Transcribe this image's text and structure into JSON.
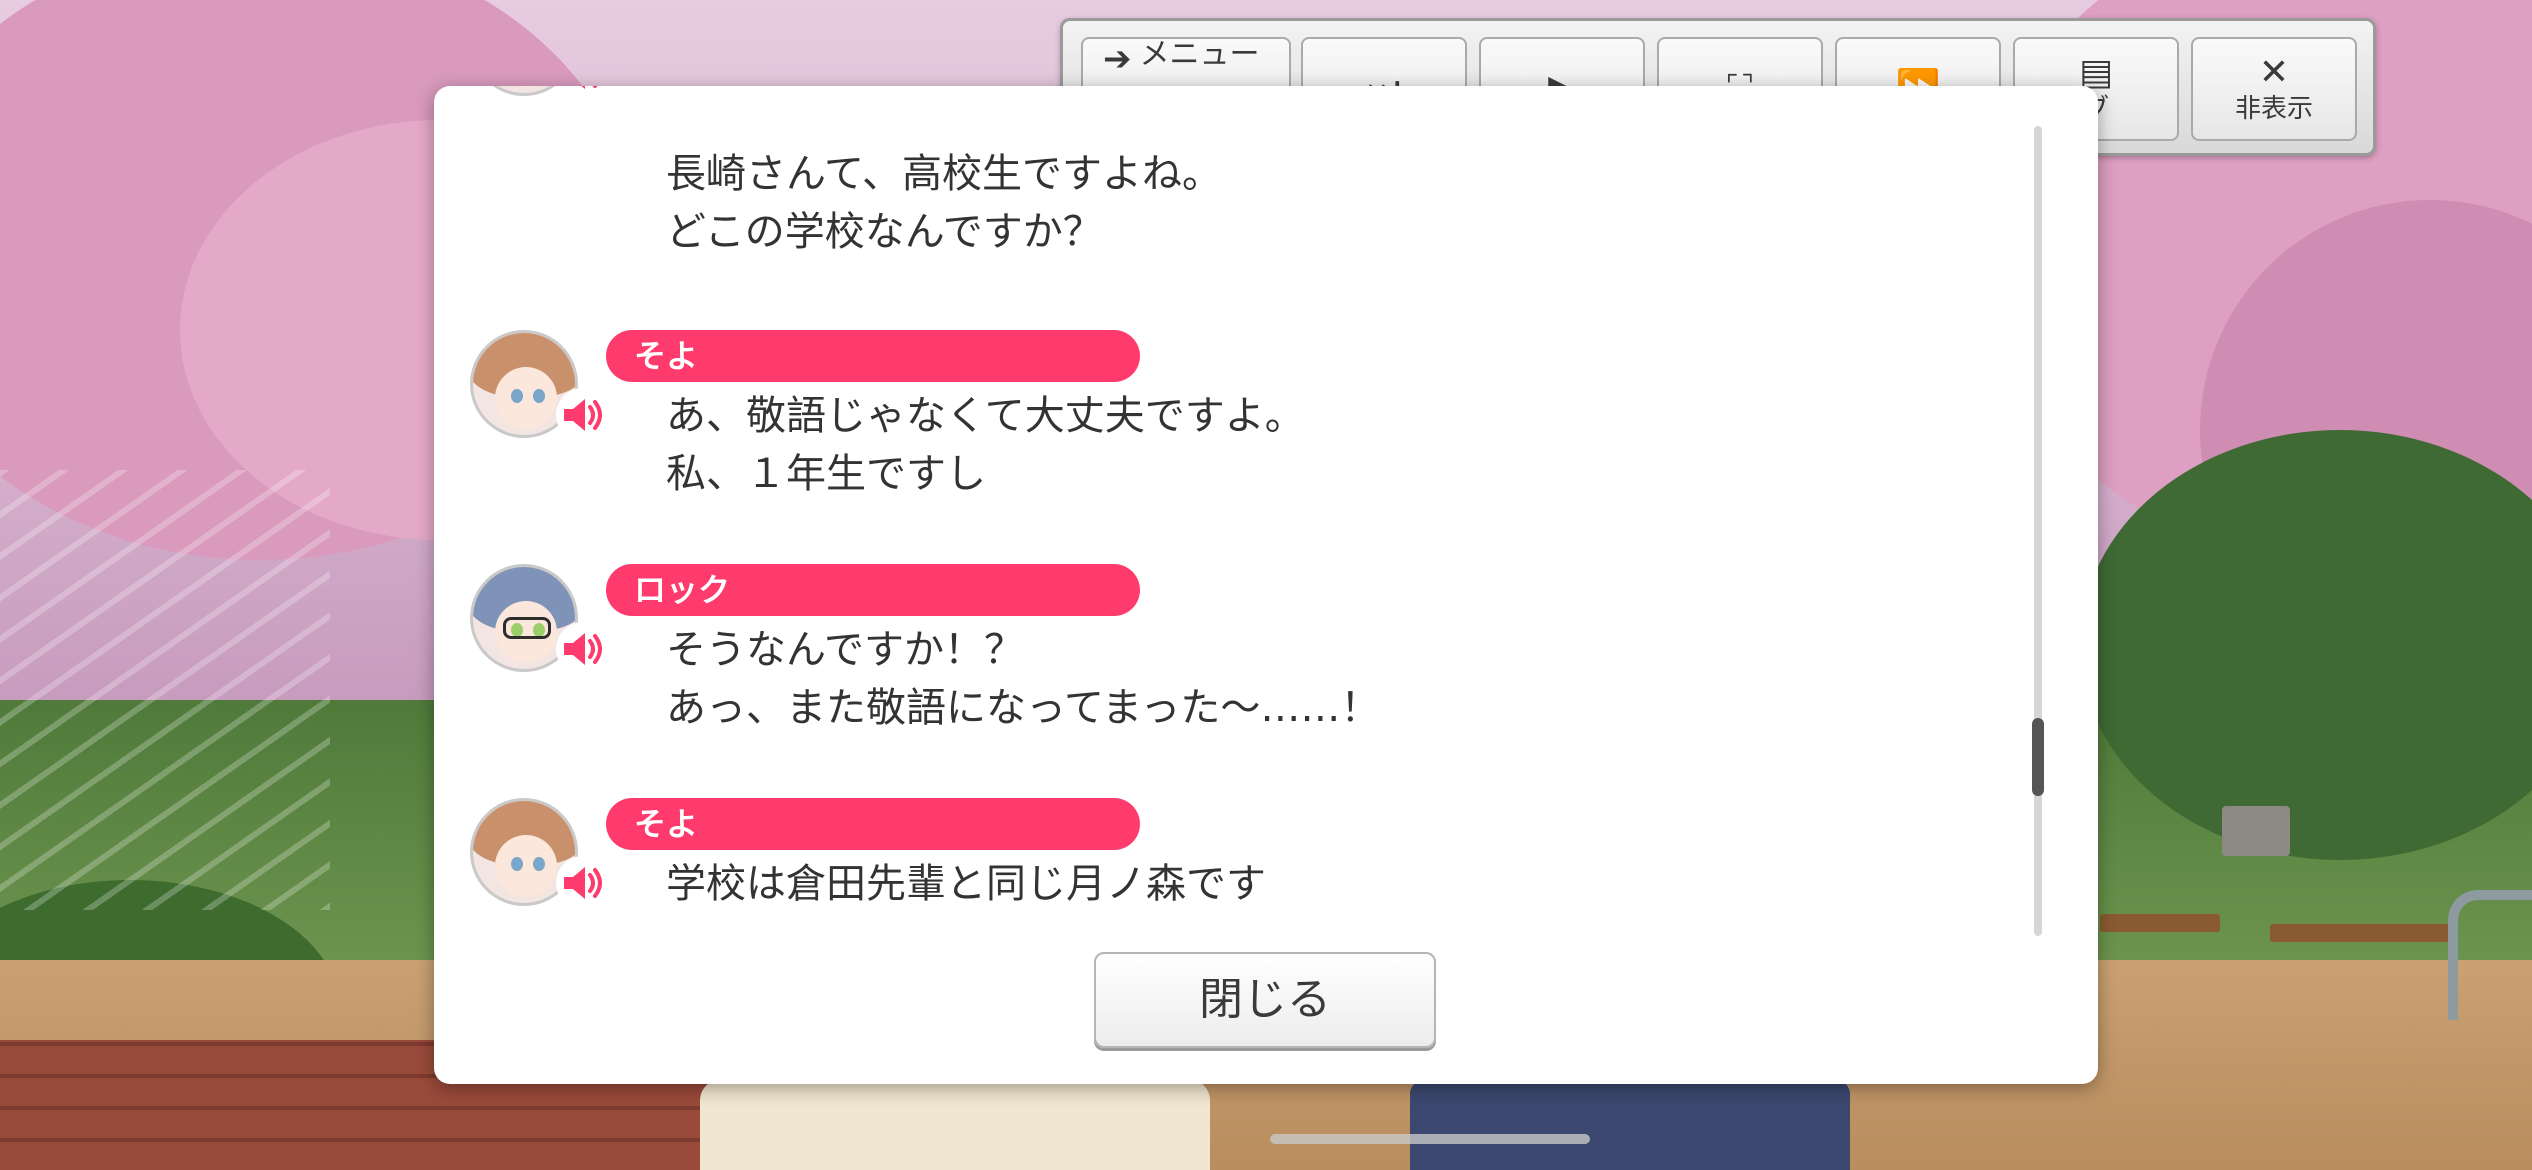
{
  "toolbar": {
    "menu_label": "メニュー",
    "hide_label": "非表示",
    "log_label_partial": "ブ"
  },
  "log": [
    {
      "name": "",
      "line1": "長崎さんて、高校生ですよね。",
      "line2": "どこの学校なんですか？",
      "avatar": "glasses"
    },
    {
      "name": "そよ",
      "line1": "あ、敬語じゃなくて大丈夫ですよ。",
      "line2": "私、１年生ですし",
      "avatar": "brown"
    },
    {
      "name": "ロック",
      "line1": "そうなんですか！？",
      "line2": "あっ、また敬語になってまった〜……！",
      "avatar": "glasses"
    },
    {
      "name": "そよ",
      "line1": "学校は倉田先輩と同じ月ノ森です",
      "line2": "",
      "avatar": "brown"
    }
  ],
  "close_label": "閉じる",
  "colors": {
    "accent": "#ff3b6e",
    "text": "#333333",
    "panel": "#ffffff"
  },
  "icons": {
    "speaker": "speaker-icon",
    "skip": "skip-icon",
    "play": "play-icon",
    "fullscreen": "fullscreen-icon",
    "fast_forward": "fast-forward-icon",
    "log": "log-icon",
    "close": "close-icon"
  }
}
